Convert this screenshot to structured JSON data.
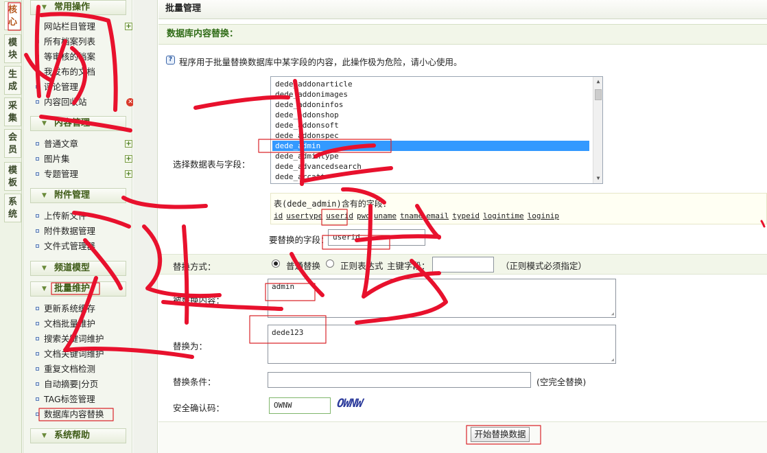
{
  "vtabs": [
    {
      "label": "核\n心",
      "active": true
    },
    {
      "label": "模\n块"
    },
    {
      "label": "生\n成"
    },
    {
      "label": "采\n集"
    },
    {
      "label": "会\n员"
    },
    {
      "label": "模\n板"
    },
    {
      "label": "系\n统"
    }
  ],
  "menu": {
    "groups": {
      "common": "常用操作",
      "content": "内容管理",
      "attach": "附件管理",
      "channel": "频道模型",
      "batch": "批量维护",
      "help": "系统帮助"
    },
    "common_items": [
      "网站栏目管理",
      "所有档案列表",
      "等审核的档案",
      "我发布的文档",
      "评论管理",
      "内容回收站"
    ],
    "content_items": [
      "普通文章",
      "图片集",
      "专题管理"
    ],
    "attach_items": [
      "上传新文件",
      "附件数据管理",
      "文件式管理器"
    ],
    "batch_items": [
      "更新系统缓存",
      "文档批量维护",
      "搜索关键词维护",
      "文档关键词维护",
      "重复文档检测",
      "自动摘要|分页",
      "TAG标签管理",
      "数据库内容替换"
    ]
  },
  "main": {
    "title": "批量管理",
    "section_title": "数据库内容替换：",
    "note": "程序用于批量替换数据库中某字段的内容，此操作极为危险，请小心使用。",
    "select_label": "选择数据表与字段：",
    "tables": [
      "dede_addonarticle",
      "dede_addonimages",
      "dede_addoninfos",
      "dede_addonshop",
      "dede_addonsoft",
      "dede_addonspec",
      "dede_admin",
      "dede_admintype",
      "dede_advancedsearch",
      "dede_arcatt"
    ],
    "selected_table": "dede_admin",
    "fields_caption": "表(dede_admin)含有的字段：",
    "fields": [
      "id",
      "usertype",
      "userid",
      "pwd",
      "uname",
      "tname",
      "email",
      "typeid",
      "logintime",
      "loginip"
    ],
    "replace_field_label": "要替换的字段：",
    "replace_field_value": "userid",
    "mode_label": "替换方式：",
    "mode_normal": "普通替换",
    "mode_regex": "正则表达式",
    "primary_key_label": "主键字段：",
    "regex_note": "（正则模式必须指定）",
    "find_label": "被替换内容：",
    "find_value": "admin",
    "replace_label": "替换为：",
    "replace_value": "dede123",
    "condition_label": "替换条件：",
    "condition_note": "(空完全替换)",
    "captcha_label": "安全确认码：",
    "captcha_input": "OWNW",
    "captcha_image": "OWNW",
    "submit": "开始替换数据"
  },
  "annotations": {
    "color": "#e8112d",
    "box_color": "#d9262b"
  }
}
